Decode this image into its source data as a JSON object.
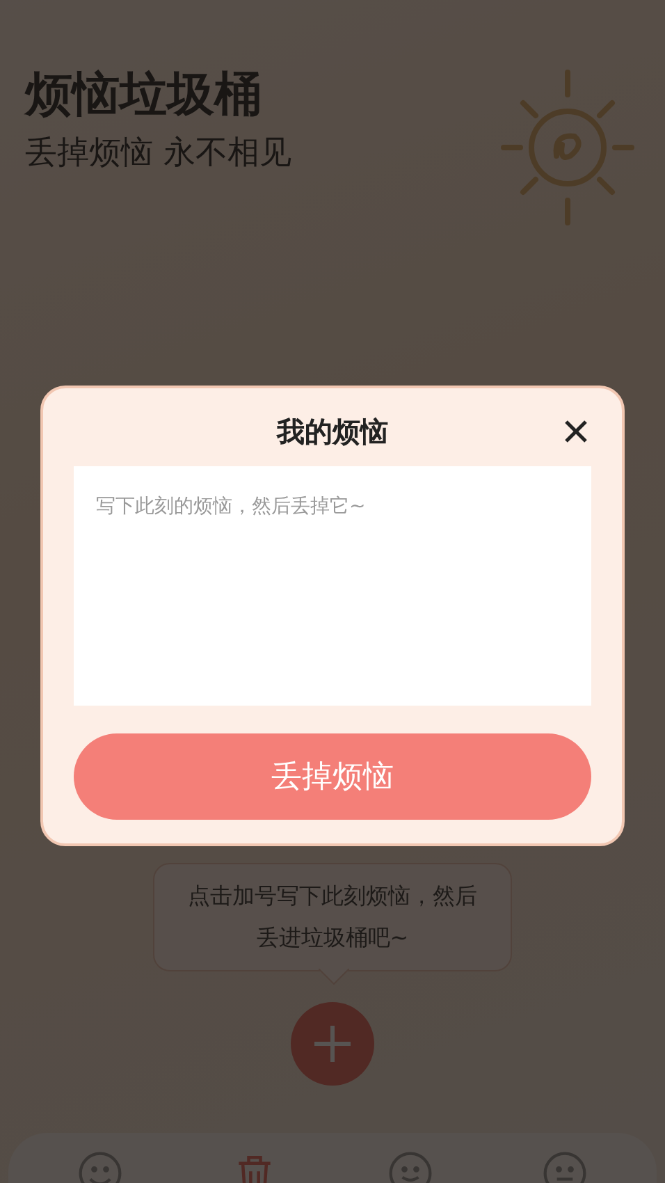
{
  "header": {
    "title": "烦恼垃圾桶",
    "subtitle": "丢掉烦恼 永不相见"
  },
  "hint": {
    "text": "点击加号写下此刻烦恼，然后丢进垃圾桶吧~"
  },
  "nav": [
    {
      "kind": "laugh",
      "selected": false
    },
    {
      "kind": "trash",
      "selected": true
    },
    {
      "kind": "smile",
      "selected": false
    },
    {
      "kind": "calm",
      "selected": false
    }
  ],
  "dialog": {
    "title": "我的烦恼",
    "placeholder": "写下此刻的烦恼，然后丢掉它~",
    "submit": "丢掉烦恼"
  }
}
